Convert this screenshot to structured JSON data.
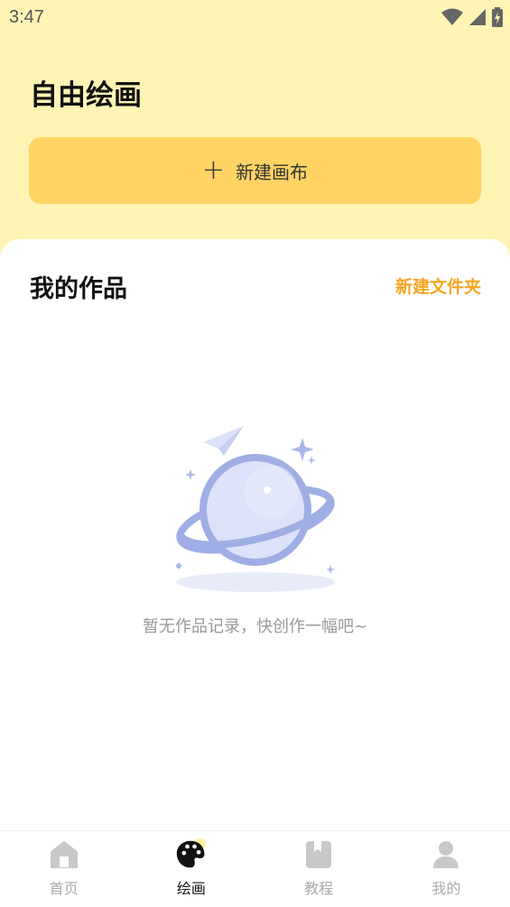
{
  "status_bar": {
    "time": "3:47"
  },
  "header": {
    "title": "自由绘画"
  },
  "new_canvas": {
    "plus": "+",
    "label": "新建画布"
  },
  "works": {
    "title": "我的作品",
    "new_folder_label": "新建文件夹",
    "empty_text": "暂无作品记录，快创作一幅吧~"
  },
  "bottom_nav": {
    "items": [
      {
        "label": "首页",
        "icon": "home-icon",
        "active": false
      },
      {
        "label": "绘画",
        "icon": "palette-icon",
        "active": true
      },
      {
        "label": "教程",
        "icon": "book-icon",
        "active": false
      },
      {
        "label": "我的",
        "icon": "user-icon",
        "active": false
      }
    ]
  },
  "colors": {
    "header_bg": "#FFF4B4",
    "button_bg": "#FFD465",
    "accent": "#F5A623",
    "illustration": "#9FAEE4"
  }
}
